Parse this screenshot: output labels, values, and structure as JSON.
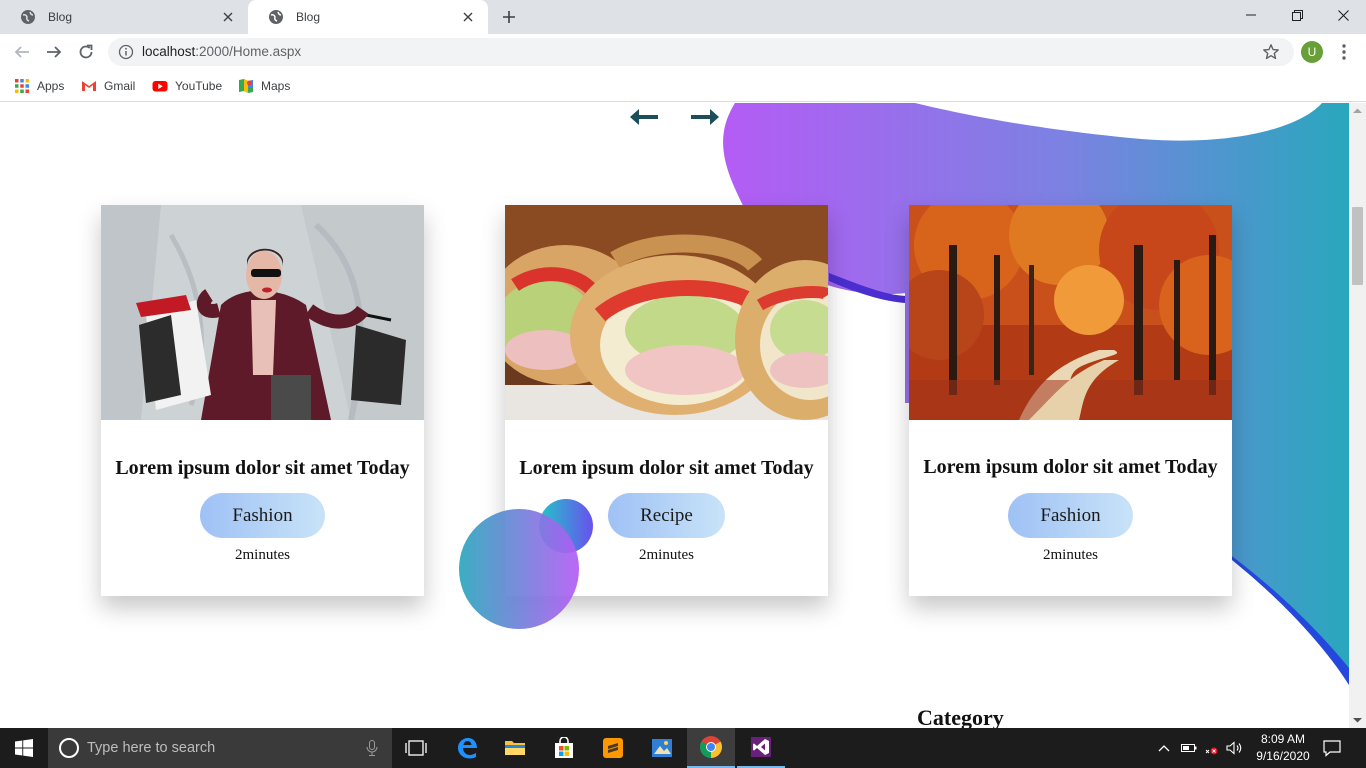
{
  "browser": {
    "tabs": [
      {
        "title": "Blog",
        "active": false
      },
      {
        "title": "Blog",
        "active": true
      }
    ],
    "address": {
      "host": "localhost",
      "path": ":2000/Home.aspx"
    },
    "profile_initial": "U",
    "bookmarks": [
      {
        "label": "Apps",
        "icon": "apps-grid-icon"
      },
      {
        "label": "Gmail",
        "icon": "gmail-icon"
      },
      {
        "label": "YouTube",
        "icon": "youtube-icon"
      },
      {
        "label": "Maps",
        "icon": "maps-icon"
      }
    ]
  },
  "page": {
    "slider_prev_icon": "arrow-left-icon",
    "slider_next_icon": "arrow-right-icon",
    "cards": [
      {
        "title": "Lorem ipsum dolor sit amet Today",
        "tag": "Fashion",
        "time": "2minutes",
        "image": "woman-with-shopping-bags"
      },
      {
        "title": "Lorem ipsum dolor sit amet Today",
        "tag": "Recipe",
        "time": "2minutes",
        "image": "sandwich"
      },
      {
        "title": "Lorem ipsum dolor sit amet Today",
        "tag": "Fashion",
        "time": "2minutes",
        "image": "autumn-forest-path"
      }
    ],
    "section_heading": "Category",
    "colors": {
      "gradient_purple": "#b45cf5",
      "gradient_teal": "#29a7bd",
      "blue_stroke": "#1c4fd8",
      "arrow": "#1d4e5c"
    }
  },
  "taskbar": {
    "search_placeholder": "Type here to search",
    "time": "8:09 AM",
    "date": "9/16/2020"
  }
}
